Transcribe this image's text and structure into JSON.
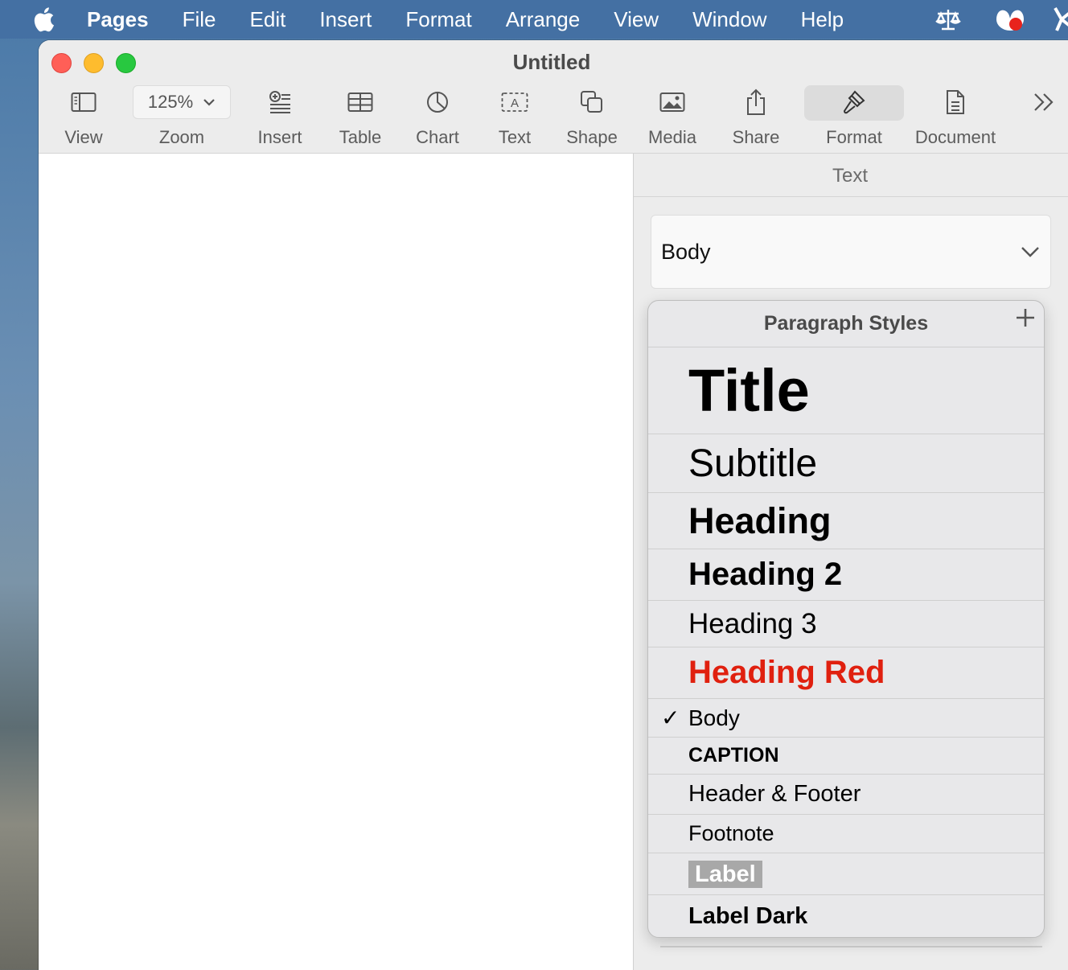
{
  "menubar": {
    "app_name": "Pages",
    "items": [
      "File",
      "Edit",
      "Insert",
      "Format",
      "Arrange",
      "View",
      "Window",
      "Help"
    ]
  },
  "window": {
    "title": "Untitled"
  },
  "toolbar": {
    "view_label": "View",
    "zoom_value": "125%",
    "zoom_label": "Zoom",
    "insert_label": "Insert",
    "table_label": "Table",
    "chart_label": "Chart",
    "text_label": "Text",
    "shape_label": "Shape",
    "media_label": "Media",
    "share_label": "Share",
    "format_label": "Format",
    "document_label": "Document"
  },
  "sidebar": {
    "tab_title": "Text",
    "style_select_value": "Body"
  },
  "popover": {
    "title": "Paragraph Styles",
    "styles": [
      {
        "label": "Title"
      },
      {
        "label": "Subtitle"
      },
      {
        "label": "Heading"
      },
      {
        "label": "Heading 2"
      },
      {
        "label": "Heading 3"
      },
      {
        "label": "Heading Red"
      },
      {
        "label": "Body",
        "checked": true
      },
      {
        "label": "CAPTION"
      },
      {
        "label": "Header & Footer"
      },
      {
        "label": "Footnote"
      },
      {
        "label": "Label"
      },
      {
        "label": "Label Dark"
      }
    ],
    "check_mark": "✓"
  },
  "colors": {
    "menubar_bg": "#4470a3",
    "heading_red": "#e0200f",
    "label_bg": "#a8a8a8"
  }
}
